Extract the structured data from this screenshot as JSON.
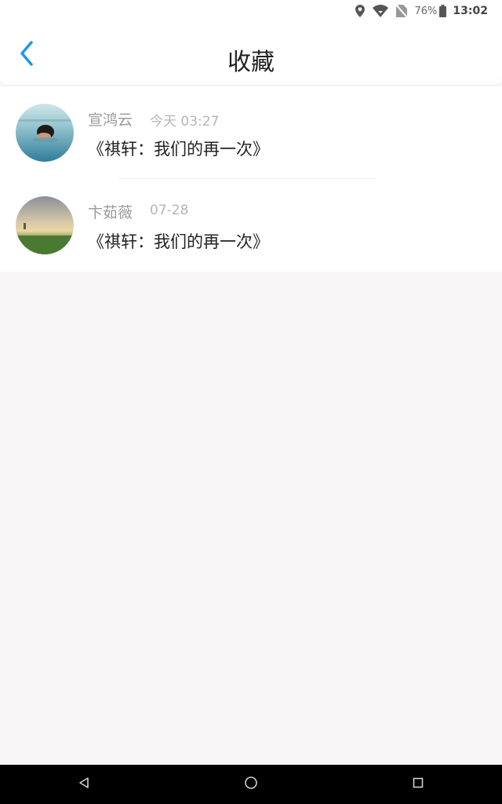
{
  "statusbar": {
    "battery": "76%",
    "time": "13:02",
    "icons": [
      "location-icon",
      "wifi-icon",
      "no-sim-icon",
      "battery-icon"
    ]
  },
  "header": {
    "title": "收藏",
    "back_icon": "chevron-left-icon",
    "accent": "#2196f3"
  },
  "favorites": [
    {
      "name": "宣鸿云",
      "time": "今天 03:27",
      "title": "《祺轩：我们的再一次》"
    },
    {
      "name": "卞茹薇",
      "time": "07-28",
      "title": "《祺轩：我们的再一次》"
    }
  ],
  "navbar": {
    "icons": [
      "back-triangle-icon",
      "home-circle-icon",
      "recents-square-icon"
    ]
  }
}
